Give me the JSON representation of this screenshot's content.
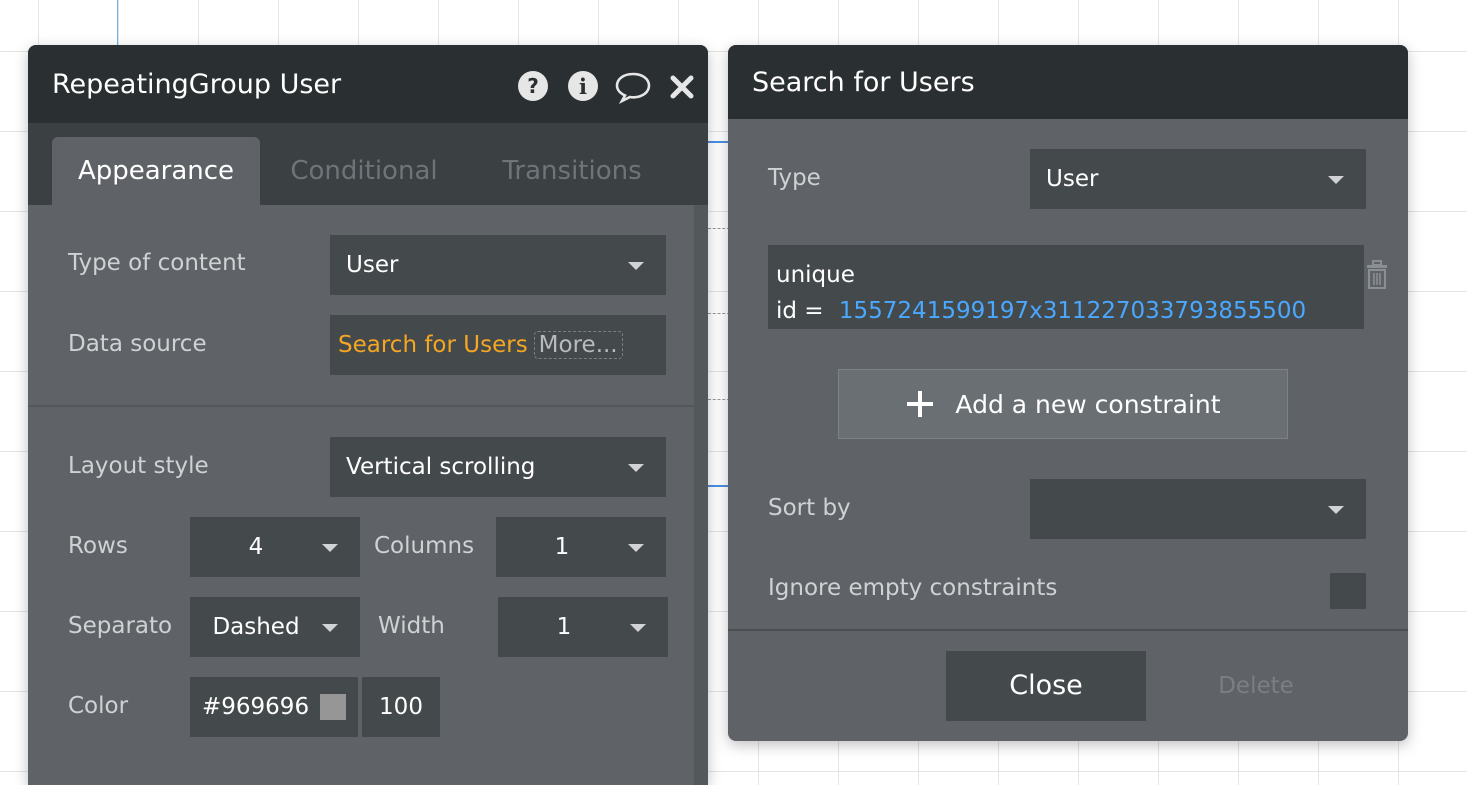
{
  "left_panel": {
    "title": "RepeatingGroup User",
    "tabs": [
      {
        "label": "Appearance"
      },
      {
        "label": "Conditional"
      },
      {
        "label": "Transitions"
      }
    ],
    "type_of_content": {
      "label": "Type of content",
      "value": "User"
    },
    "data_source": {
      "label": "Data source",
      "value": "Search for Users",
      "more": "More..."
    },
    "layout_style": {
      "label": "Layout style",
      "value": "Vertical scrolling"
    },
    "rows": {
      "label": "Rows",
      "value": "4"
    },
    "columns": {
      "label": "Columns",
      "value": "1"
    },
    "separator": {
      "label": "Separato",
      "value": "Dashed"
    },
    "width": {
      "label": "Width",
      "value": "1"
    },
    "color": {
      "label": "Color",
      "hex": "#969696",
      "opacity": "100"
    }
  },
  "right_panel": {
    "title": "Search for Users",
    "type": {
      "label": "Type",
      "value": "User"
    },
    "constraint": {
      "field": "unique",
      "operator": "id =",
      "value": "1557241599197x311227033793855500"
    },
    "add_constraint_label": "Add a new constraint",
    "sort_by": {
      "label": "Sort by",
      "value": ""
    },
    "ignore_empty": {
      "label": "Ignore empty constraints"
    },
    "close_label": "Close",
    "delete_label": "Delete"
  },
  "colors": {
    "header_bg": "#2a2f31",
    "panel_bg": "#5f6368",
    "field_bg": "#44494c",
    "accent_orange": "#f5a623",
    "link_blue": "#4aa8ff",
    "swatch": "#969696"
  },
  "icons": [
    "question-icon",
    "info-icon",
    "comment-icon",
    "close-icon",
    "trash-icon",
    "plus-icon"
  ]
}
